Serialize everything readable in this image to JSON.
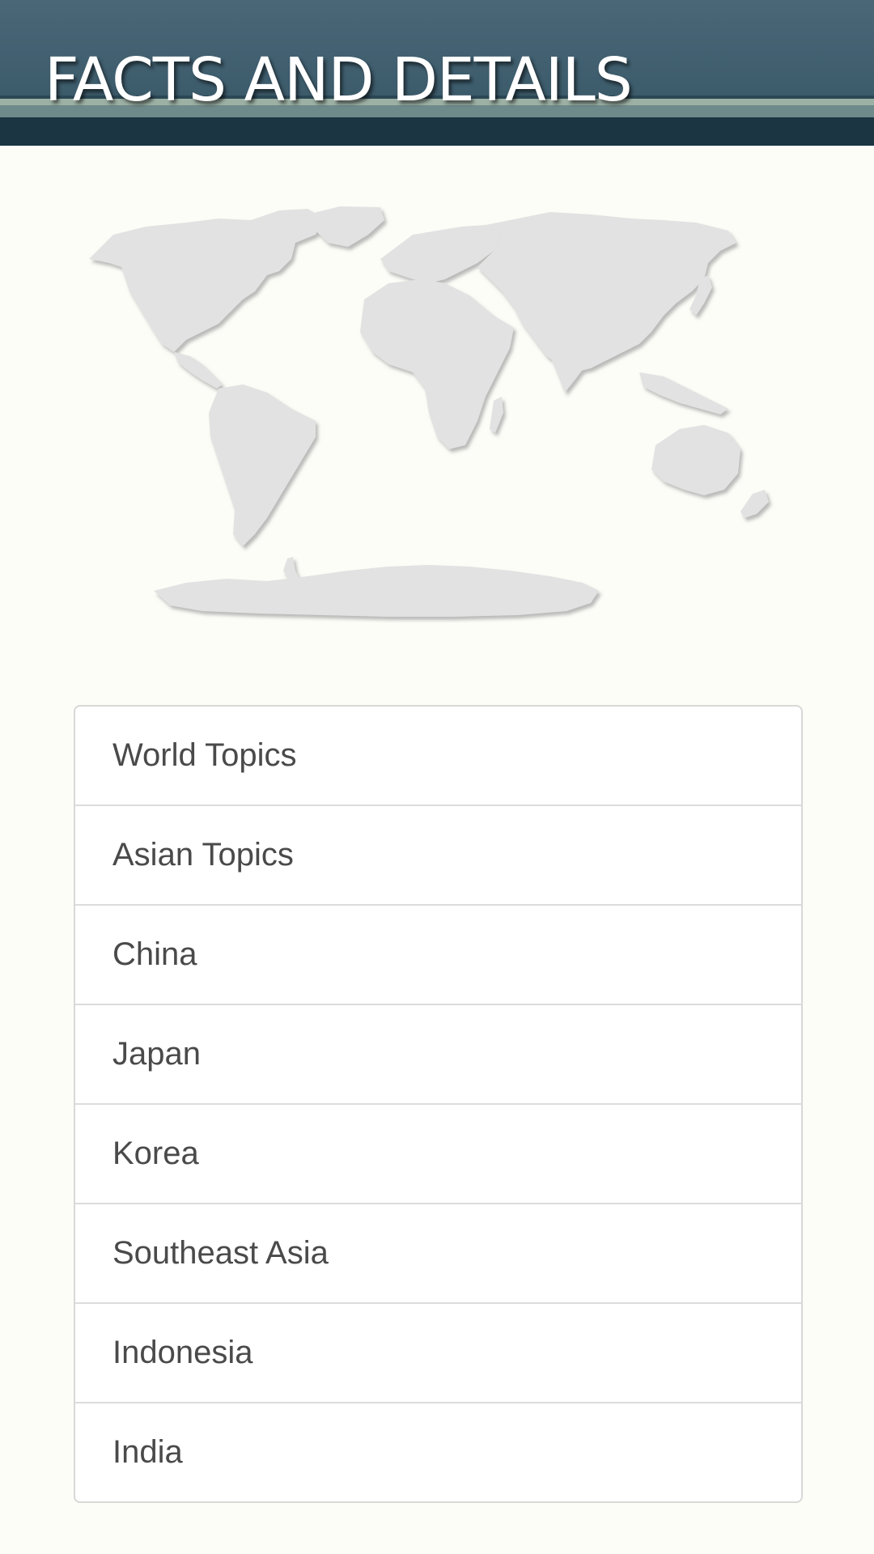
{
  "header": {
    "title": "FACTS AND DETAILS",
    "colors": {
      "background": "#3d5c6c",
      "band_light": "#9cb0a4",
      "band_dark": "#1b3542",
      "title_text": "#ffffff"
    }
  },
  "map": {
    "icon": "world-map-icon",
    "fill_color": "#e2e2e2",
    "shadow_color": "#b8b8b8"
  },
  "topics": {
    "items": [
      {
        "label": "World Topics"
      },
      {
        "label": "Asian Topics"
      },
      {
        "label": "China"
      },
      {
        "label": "Japan"
      },
      {
        "label": "Korea"
      },
      {
        "label": "Southeast Asia"
      },
      {
        "label": "Indonesia"
      },
      {
        "label": "India"
      }
    ]
  },
  "page": {
    "background": "#fcfdf7"
  }
}
